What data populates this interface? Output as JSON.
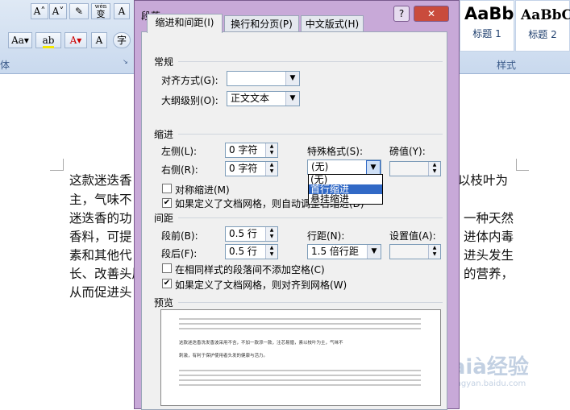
{
  "ribbon": {
    "font_buttons": [
      "A˄",
      "A˅",
      "Aa▾",
      "变",
      "A",
      "A▾",
      "A▾",
      "A",
      "字"
    ],
    "wen_label": "wén",
    "group_font": "体",
    "group_styles": "样式",
    "styles": [
      {
        "sample": "AaBb",
        "name": "标题 1"
      },
      {
        "sample": "AaBbC",
        "name": "标题 2"
      }
    ]
  },
  "document": {
    "lines": [
      {
        "left": "这款迷迭香",
        "right": "以枝叶为"
      },
      {
        "left": "主，气味不",
        "right": ""
      },
      {
        "left": "迷迭香的功",
        "right": "一种天然"
      },
      {
        "left": "香料，可提",
        "right": "进体内毒"
      },
      {
        "left": "素和其他代",
        "right": "进头发生"
      },
      {
        "left": "长、改善头屑",
        "right": "的营养，"
      },
      {
        "left": "从而促进头",
        "right": ""
      }
    ]
  },
  "dialog": {
    "title": "段落",
    "help": "?",
    "close": "✕",
    "tabs": [
      "缩进和间距(I)",
      "换行和分页(P)",
      "中文版式(H)"
    ],
    "general": {
      "heading": "常规",
      "alignment_label": "对齐方式(G):",
      "alignment_value": "",
      "outline_label": "大纲级别(O):",
      "outline_value": "正文文本"
    },
    "indent": {
      "heading": "缩进",
      "left_label": "左侧(L):",
      "left_value": "0 字符",
      "right_label": "右侧(R):",
      "right_value": "0 字符",
      "special_label": "特殊格式(S):",
      "special_value": "(无)",
      "special_options": [
        "(无)",
        "首行缩进",
        "悬挂缩进"
      ],
      "measure_label": "磅值(Y):",
      "measure_value": "",
      "mirror_label": "对称缩进(M)",
      "mirror_checked": false,
      "auto_adjust_label": "如果定义了文档网格，则自动调整右缩进(D)",
      "auto_adjust_checked": true
    },
    "spacing": {
      "heading": "间距",
      "before_label": "段前(B):",
      "before_value": "0.5 行",
      "after_label": "段后(F):",
      "after_value": "0.5 行",
      "line_label": "行距(N):",
      "line_value": "1.5 倍行距",
      "at_label": "设置值(A):",
      "at_value": "",
      "no_space_label": "在相同样式的段落间不添加空格(C)",
      "no_space_checked": false,
      "snap_grid_label": "如果定义了文档网格，则对齐到网格(W)",
      "snap_grid_checked": true
    },
    "preview": {
      "heading": "预览",
      "sample_lines": [
        "这款迷迭香洗发香波采用不含，不加一款添一款，注芯易循，素以枝叶为主，气味不",
        "刺激，有利于保护使用者头发的健康与活力。"
      ]
    }
  },
  "watermark": {
    "text": "Baià经验",
    "sub": "jingyan.baidu.com"
  }
}
